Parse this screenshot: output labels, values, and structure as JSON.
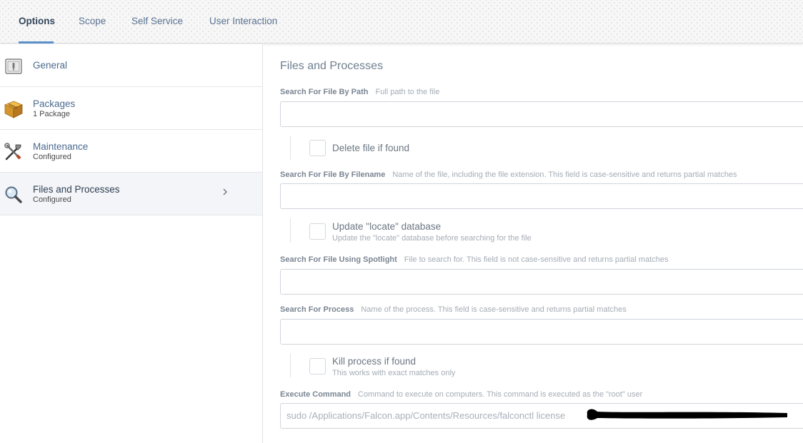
{
  "tabs": [
    {
      "label": "Options",
      "active": true
    },
    {
      "label": "Scope",
      "active": false
    },
    {
      "label": "Self Service",
      "active": false
    },
    {
      "label": "User Interaction",
      "active": false
    }
  ],
  "sidebar": {
    "items": [
      {
        "title": "General",
        "subtitle": "",
        "icon": "general-icon"
      },
      {
        "title": "Packages",
        "subtitle": "1 Package",
        "icon": "package-box-icon"
      },
      {
        "title": "Maintenance",
        "subtitle": "Configured",
        "icon": "tools-icon"
      },
      {
        "title": "Files and Processes",
        "subtitle": "Configured",
        "icon": "magnifier-icon",
        "selected": true
      }
    ]
  },
  "main": {
    "section_title": "Files and Processes",
    "search_path": {
      "label": "Search For File By Path",
      "help": "Full path to the file",
      "value": ""
    },
    "delete_file": {
      "label": "Delete file if found",
      "checked": false
    },
    "search_filename": {
      "label": "Search For File By Filename",
      "help": "Name of the file, including the file extension. This field is case-sensitive and returns partial matches",
      "value": ""
    },
    "update_locate": {
      "label": "Update \"locate\" database",
      "sublabel": "Update the \"locate\" database before searching for the file",
      "checked": false
    },
    "search_spotlight": {
      "label": "Search For File Using Spotlight",
      "help": "File to search for. This field is not case-sensitive and returns partial matches",
      "value": ""
    },
    "search_process": {
      "label": "Search For Process",
      "help": "Name of the process. This field is case-sensitive and returns partial matches",
      "value": ""
    },
    "kill_process": {
      "label": "Kill process if found",
      "sublabel": "This works with exact matches only",
      "checked": false
    },
    "execute_command": {
      "label": "Execute Command",
      "help": "Command to execute on computers. This command is executed as the \"root\" user",
      "value": "sudo /Applications/Falcon.app/Contents/Resources/falconctl license"
    }
  },
  "colors": {
    "accent": "#5b8fc9",
    "link": "#4c6b8f",
    "redaction": "#000000"
  }
}
